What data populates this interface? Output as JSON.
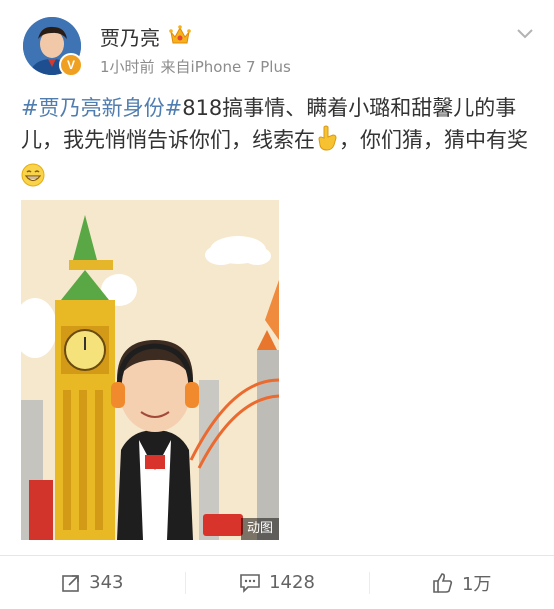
{
  "header": {
    "username": "贾乃亮",
    "time": "1小时前",
    "source": "来自iPhone 7 Plus",
    "verified_badge": "V"
  },
  "post": {
    "hashtag": "#贾乃亮新身份#",
    "text_1": "818搞事情、瞒着小璐和甜馨儿的事儿，我先悄悄告诉你们，线索在",
    "text_2": "，你们猜，猜中有奖",
    "emoji_1": "point-down-icon",
    "emoji_2": "grin-emoji-icon"
  },
  "media": {
    "gif_label": "动图"
  },
  "actions": {
    "repost_count": "343",
    "comment_count": "1428",
    "like_count": "1万"
  },
  "colors": {
    "hashtag": "#507daf",
    "text": "#333333",
    "meta": "#8c8c8c",
    "action": "#636363"
  }
}
